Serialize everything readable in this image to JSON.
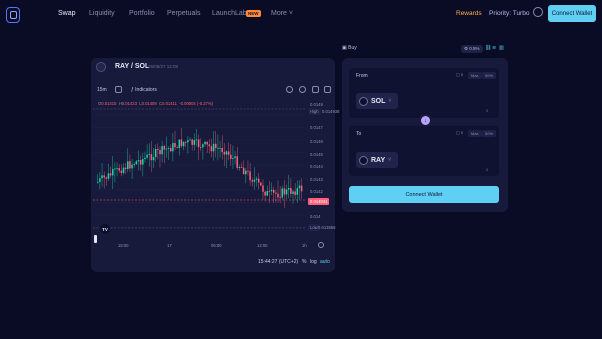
{
  "nav": {
    "items": [
      "Swap",
      "Liquidity",
      "Portfolio",
      "Perpetuals",
      "LaunchLab",
      "More"
    ],
    "new_tag": "NEW",
    "rewards": "Rewards",
    "priority": "Priority: Turbo",
    "connect_wallet": "Connect Wallet"
  },
  "chart": {
    "pair": "RAY / SOL",
    "sub": "25/06/27 12:08",
    "interval": "15m",
    "indicators": "Indicators",
    "ohlc": {
      "o_label": "O",
      "o": "0.01415",
      "h_label": "H",
      "h": "0.01423",
      "l_label": "L",
      "l": "0.01409",
      "c_label": "C",
      "c": "0.01411",
      "change": "-0.00004 (-0.27%)"
    },
    "high_label": "High",
    "high_value": "0.014938",
    "low_label": "Low",
    "low_value": "0.013658",
    "current_price": "0.014041",
    "price_ticks": [
      "0.0149",
      "0.0148",
      "0.0147",
      "0.0146",
      "0.0145",
      "0.0144",
      "0.0143",
      "0.0142",
      "0.0141",
      "0.014",
      "0.0139"
    ],
    "time_ticks": [
      "18:00",
      "17",
      "06:00",
      "12:00"
    ],
    "footer_time": "15:44:27 (UTC+2)",
    "footer_pct": "%",
    "footer_log": "log",
    "footer_auto": "auto",
    "range_label": "1h",
    "tv_logo": "TV"
  },
  "swap": {
    "mode": "Buy",
    "slippage": "0.5%",
    "from_label": "From",
    "to_label": "To",
    "from_token": "SOL",
    "to_token": "RAY",
    "max": "Max",
    "half": "50%",
    "from_amount": "0",
    "to_amount": "0",
    "connect_wallet": "Connect Wallet"
  },
  "colors": {
    "up": "#19d6a7",
    "down": "#ff5f7a",
    "accent": "#5fd0f3"
  }
}
